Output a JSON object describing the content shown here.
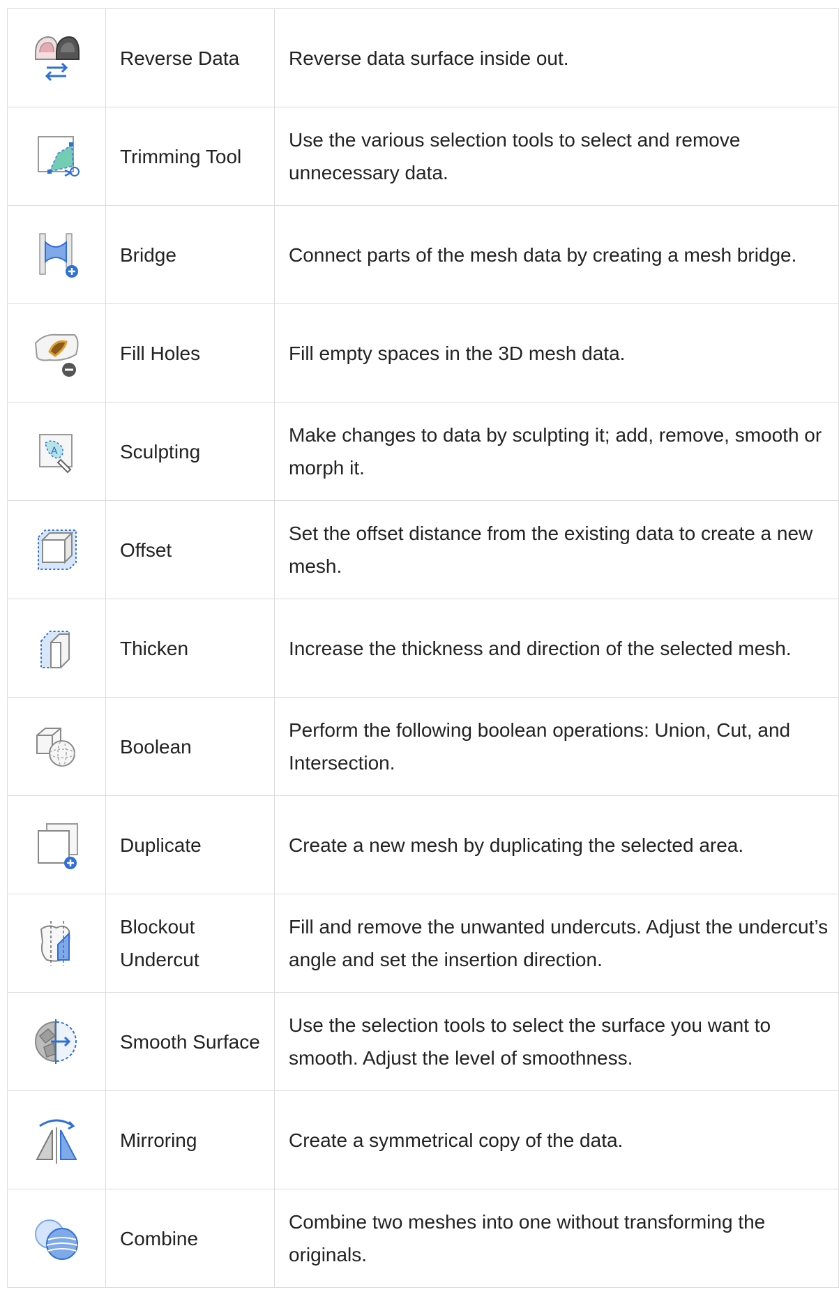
{
  "rows": [
    {
      "icon": "reverse-data-icon",
      "name": "Reverse Data",
      "description": "Reverse data surface inside out."
    },
    {
      "icon": "trimming-tool-icon",
      "name": "Trimming Tool",
      "description": "Use the various selection tools to select and remove unnecessary data."
    },
    {
      "icon": "bridge-icon",
      "name": "Bridge",
      "description": "Connect parts of the mesh data by creating a mesh bridge."
    },
    {
      "icon": "fill-holes-icon",
      "name": "Fill Holes",
      "description": "Fill empty spaces in the 3D mesh data."
    },
    {
      "icon": "sculpting-icon",
      "name": "Sculpting",
      "description": "Make changes to data by sculpting it; add, remove, smooth or morph it."
    },
    {
      "icon": "offset-icon",
      "name": "Offset",
      "description": "Set the offset distance from the existing data to create a new mesh."
    },
    {
      "icon": "thicken-icon",
      "name": "Thicken",
      "description": "Increase the thickness and direction of the selected mesh."
    },
    {
      "icon": "boolean-icon",
      "name": "Boolean",
      "description": "Perform the following boolean operations: Union, Cut, and Intersection."
    },
    {
      "icon": "duplicate-icon",
      "name": "Duplicate",
      "description": "Create a new mesh by duplicating the selected area."
    },
    {
      "icon": "blockout-undercut-icon",
      "name": "Blockout Undercut",
      "description": "Fill and remove the unwanted undercuts. Adjust the undercut’s angle and set the insertion direction."
    },
    {
      "icon": "smooth-surface-icon",
      "name": "Smooth Surface",
      "description": "Use the selection tools to select the surface you want to smooth. Adjust the level of smoothness."
    },
    {
      "icon": "mirroring-icon",
      "name": "Mirroring",
      "description": "Create a symmetrical copy of the data."
    },
    {
      "icon": "combine-icon",
      "name": "Combine",
      "description": "Combine two meshes into one without transforming the originals."
    }
  ],
  "colors": {
    "accent": "#2f6fd6",
    "border": "#dcdcdc",
    "text": "#222222"
  }
}
